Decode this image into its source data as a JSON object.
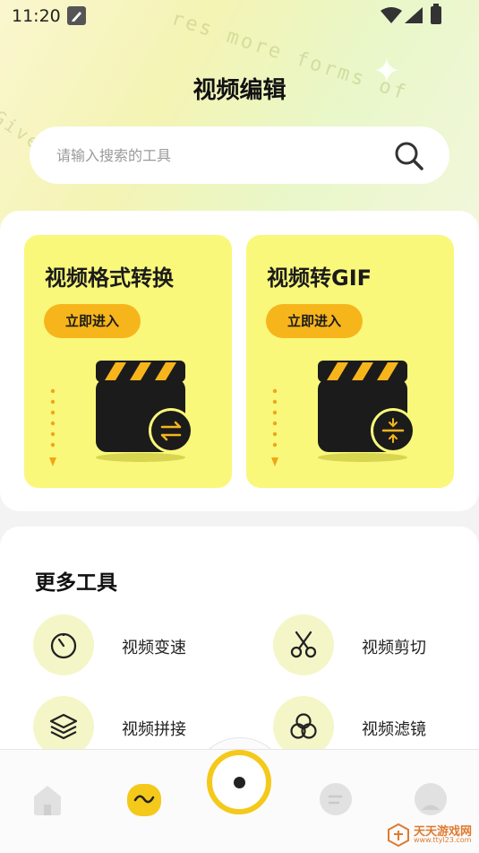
{
  "status_bar": {
    "time": "11:20"
  },
  "header": {
    "title": "视频编辑",
    "deco_text_1": "res more forms of",
    "deco_text_2": "Give our"
  },
  "search": {
    "placeholder": "请输入搜索的工具"
  },
  "feature_cards": [
    {
      "title": "视频格式转换",
      "button": "立即进入",
      "badge_icon": "swap-arrows-icon"
    },
    {
      "title": "视频转GIF",
      "button": "立即进入",
      "badge_icon": "compress-icon"
    }
  ],
  "more_tools": {
    "title": "更多工具",
    "items": [
      {
        "label": "视频变速",
        "icon": "speedometer-icon"
      },
      {
        "label": "视频剪切",
        "icon": "scissors-icon"
      },
      {
        "label": "视频拼接",
        "icon": "layers-icon"
      },
      {
        "label": "视频滤镜",
        "icon": "filter-circles-icon"
      }
    ]
  },
  "bottom_nav": {
    "items": [
      "home-icon",
      "wave-icon",
      "record-icon",
      "message-icon",
      "profile-icon"
    ]
  },
  "watermark": {
    "text": "天天游戏网",
    "url": "www.ttyl23.com"
  },
  "colors": {
    "card_bg": "#f9f87a",
    "button_bg": "#f7b51c",
    "tool_circle_bg": "#f5f6c7",
    "nav_accent": "#f4c91a"
  }
}
